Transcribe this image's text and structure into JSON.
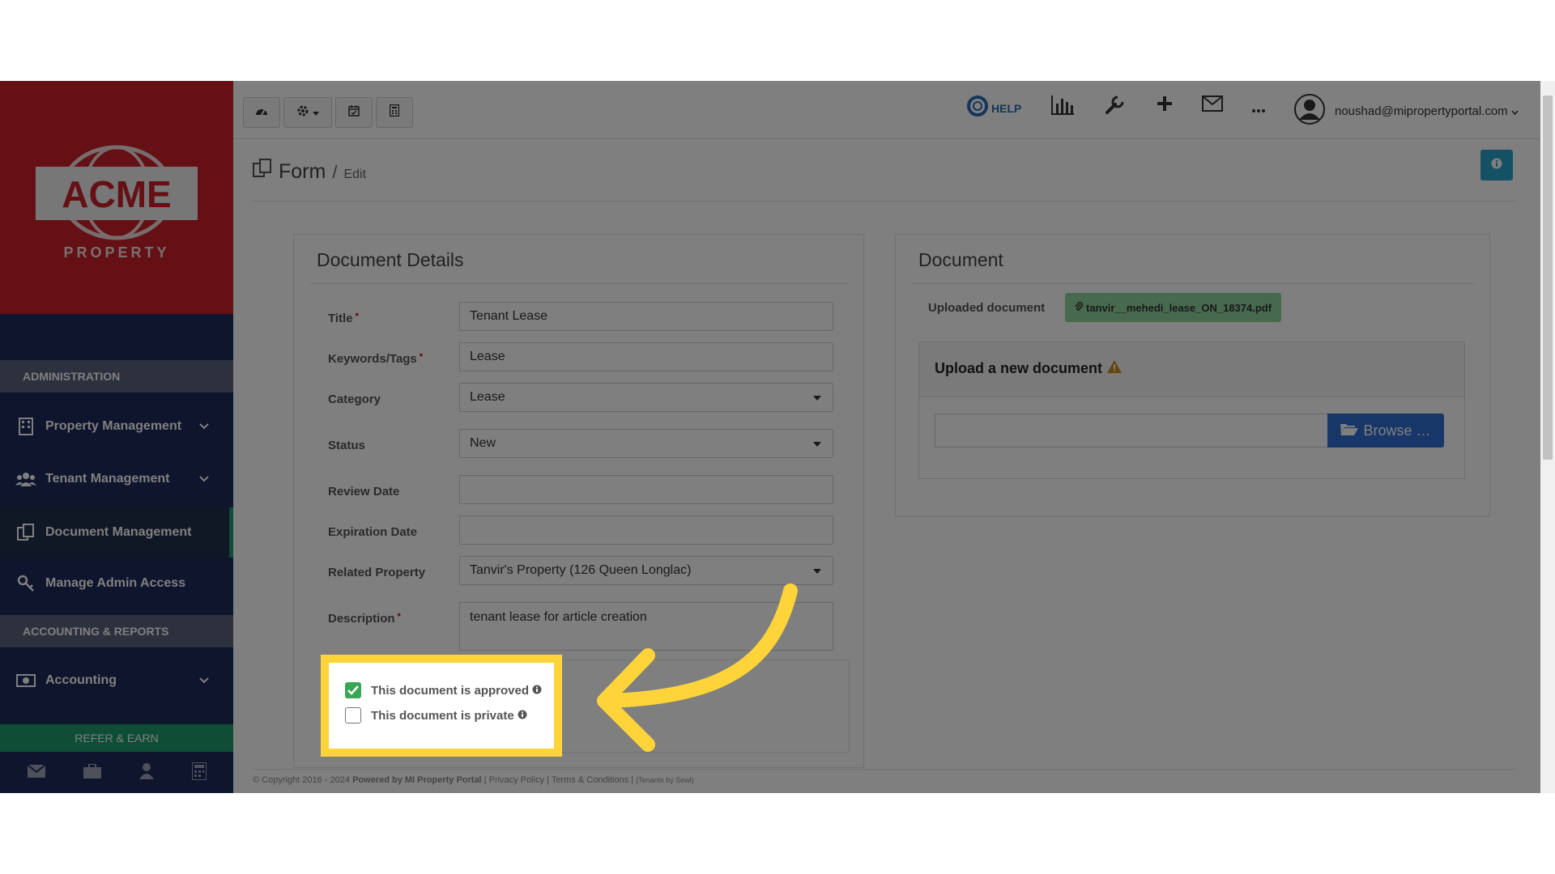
{
  "logo": {
    "brand": "ACME",
    "tagline": "PROPERTY"
  },
  "sidebar": {
    "section_admin": "ADMINISTRATION",
    "section_accounting": "ACCOUNTING & REPORTS",
    "items": [
      {
        "label": "Property Management",
        "icon": "building-icon"
      },
      {
        "label": "Tenant Management",
        "icon": "users-icon"
      },
      {
        "label": "Document Management",
        "icon": "documents-icon"
      },
      {
        "label": "Manage Admin Access",
        "icon": "key-icon"
      },
      {
        "label": "Accounting",
        "icon": "money-icon"
      }
    ],
    "refer": "REFER & EARN"
  },
  "topbar": {
    "help": "HELP",
    "user_email": "noushad@mipropertyportal.com"
  },
  "breadcrumb": {
    "title": "Form",
    "separator": "/",
    "sub": "Edit"
  },
  "details": {
    "title": "Document Details",
    "fields": {
      "title_label": "Title",
      "title_value": "Tenant Lease",
      "keywords_label": "Keywords/Tags",
      "keywords_value": "Lease",
      "category_label": "Category",
      "category_value": "Lease",
      "status_label": "Status",
      "status_value": "New",
      "review_label": "Review Date",
      "review_value": "",
      "expiration_label": "Expiration Date",
      "expiration_value": "",
      "property_label": "Related Property",
      "property_value": "Tanvir's Property (126 Queen Longlac)",
      "description_label": "Description",
      "description_value": "tenant lease for article creation"
    },
    "checkboxes": {
      "approved_label": "This document is approved",
      "approved_checked": true,
      "private_label": "This document is private",
      "private_checked": false
    }
  },
  "document": {
    "title": "Document",
    "uploaded_label": "Uploaded document",
    "uploaded_file": "tanvir__mehedi_lease_ON_18374.pdf",
    "upload_title": "Upload a new document",
    "browse": "Browse …"
  },
  "footer": {
    "copyright": "© Copyright 2016 - 2024",
    "powered": "Powered by MI Property Portal",
    "privacy": "Privacy Policy",
    "terms": "Terms & Conditions",
    "extra": "(Tenants by Sewl)"
  },
  "colors": {
    "brand_red": "#c8202a",
    "sidebar_navy": "#1c2b5a",
    "accent_green": "#1f9a6e",
    "highlight_yellow": "#ffd43b",
    "browse_blue": "#2f6fd0"
  }
}
